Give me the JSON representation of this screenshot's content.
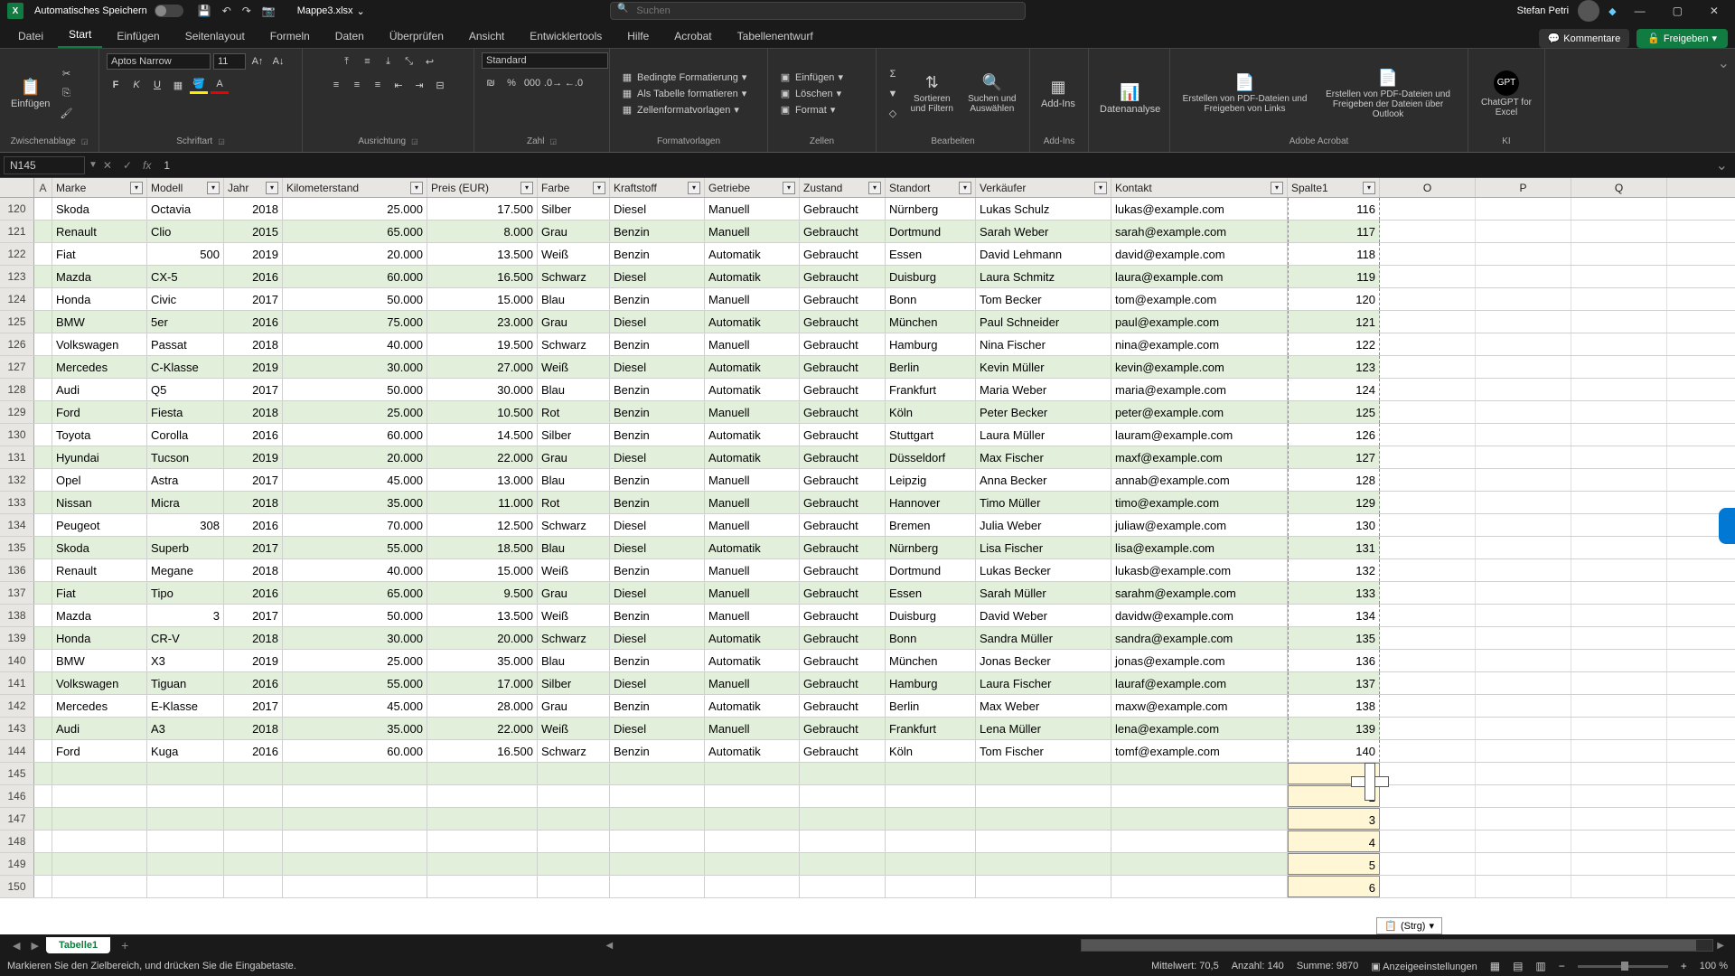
{
  "titlebar": {
    "autosave": "Automatisches Speichern",
    "filename": "Mappe3.xlsx",
    "search_placeholder": "Suchen",
    "user": "Stefan Petri"
  },
  "tabs": {
    "datei": "Datei",
    "start": "Start",
    "einfuegen": "Einfügen",
    "seitenlayout": "Seitenlayout",
    "formeln": "Formeln",
    "daten": "Daten",
    "ueberpruefen": "Überprüfen",
    "ansicht": "Ansicht",
    "entwickler": "Entwicklertools",
    "hilfe": "Hilfe",
    "acrobat": "Acrobat",
    "tabellenentwurf": "Tabellenentwurf",
    "kommentare": "Kommentare",
    "freigeben": "Freigeben"
  },
  "ribbon": {
    "zwischenablage": {
      "label": "Zwischenablage",
      "einfuegen": "Einfügen"
    },
    "schriftart": {
      "label": "Schriftart",
      "font": "Aptos Narrow",
      "size": "11"
    },
    "ausrichtung": {
      "label": "Ausrichtung"
    },
    "zahl": {
      "label": "Zahl",
      "format": "Standard"
    },
    "formatvorlagen": {
      "label": "Formatvorlagen",
      "bedingte": "Bedingte Formatierung",
      "alstabelle": "Als Tabelle formatieren",
      "zellen": "Zellenformatvorlagen"
    },
    "zellen": {
      "label": "Zellen",
      "einfuegen": "Einfügen",
      "loeschen": "Löschen",
      "format": "Format"
    },
    "bearbeiten": {
      "label": "Bearbeiten",
      "sortieren": "Sortieren und Filtern",
      "suchen": "Suchen und Auswählen"
    },
    "addins": {
      "label": "Add-Ins",
      "addins": "Add-Ins"
    },
    "analyse": {
      "label": "",
      "datenanalyse": "Datenanalyse"
    },
    "adobe": {
      "label": "Adobe Acrobat",
      "pdf1": "Erstellen von PDF-Dateien und Freigeben von Links",
      "pdf2": "Erstellen von PDF-Dateien und Freigeben der Dateien über Outlook"
    },
    "ki": {
      "label": "KI",
      "chatgpt": "ChatGPT for Excel"
    }
  },
  "formula": {
    "namebox": "N145",
    "value": "1"
  },
  "headers": {
    "a": "A",
    "marke": "Marke",
    "modell": "Modell",
    "jahr": "Jahr",
    "km": "Kilometerstand",
    "preis": "Preis (EUR)",
    "farbe": "Farbe",
    "kraft": "Kraftstoff",
    "getriebe": "Getriebe",
    "zustand": "Zustand",
    "standort": "Standort",
    "verk": "Verkäufer",
    "kontakt": "Kontakt",
    "spalte": "Spalte1",
    "o": "O",
    "p": "P",
    "q": "Q"
  },
  "rows": [
    {
      "n": 120,
      "marke": "Skoda",
      "modell": "Octavia",
      "jahr": "2018",
      "km": "25.000",
      "preis": "17.500",
      "farbe": "Silber",
      "kraft": "Diesel",
      "getriebe": "Manuell",
      "zustand": "Gebraucht",
      "standort": "Nürnberg",
      "verk": "Lukas Schulz",
      "kontakt": "lukas@example.com",
      "sp": "116"
    },
    {
      "n": 121,
      "marke": "Renault",
      "modell": "Clio",
      "jahr": "2015",
      "km": "65.000",
      "preis": "8.000",
      "farbe": "Grau",
      "kraft": "Benzin",
      "getriebe": "Manuell",
      "zustand": "Gebraucht",
      "standort": "Dortmund",
      "verk": "Sarah Weber",
      "kontakt": "sarah@example.com",
      "sp": "117"
    },
    {
      "n": 122,
      "marke": "Fiat",
      "modell": "500",
      "jahr": "2019",
      "km": "20.000",
      "preis": "13.500",
      "farbe": "Weiß",
      "kraft": "Benzin",
      "getriebe": "Automatik",
      "zustand": "Gebraucht",
      "standort": "Essen",
      "verk": "David Lehmann",
      "kontakt": "david@example.com",
      "sp": "118"
    },
    {
      "n": 123,
      "marke": "Mazda",
      "modell": "CX-5",
      "jahr": "2016",
      "km": "60.000",
      "preis": "16.500",
      "farbe": "Schwarz",
      "kraft": "Diesel",
      "getriebe": "Automatik",
      "zustand": "Gebraucht",
      "standort": "Duisburg",
      "verk": "Laura Schmitz",
      "kontakt": "laura@example.com",
      "sp": "119"
    },
    {
      "n": 124,
      "marke": "Honda",
      "modell": "Civic",
      "jahr": "2017",
      "km": "50.000",
      "preis": "15.000",
      "farbe": "Blau",
      "kraft": "Benzin",
      "getriebe": "Manuell",
      "zustand": "Gebraucht",
      "standort": "Bonn",
      "verk": "Tom Becker",
      "kontakt": "tom@example.com",
      "sp": "120"
    },
    {
      "n": 125,
      "marke": "BMW",
      "modell": "5er",
      "jahr": "2016",
      "km": "75.000",
      "preis": "23.000",
      "farbe": "Grau",
      "kraft": "Diesel",
      "getriebe": "Automatik",
      "zustand": "Gebraucht",
      "standort": "München",
      "verk": "Paul Schneider",
      "kontakt": "paul@example.com",
      "sp": "121"
    },
    {
      "n": 126,
      "marke": "Volkswagen",
      "modell": "Passat",
      "jahr": "2018",
      "km": "40.000",
      "preis": "19.500",
      "farbe": "Schwarz",
      "kraft": "Benzin",
      "getriebe": "Manuell",
      "zustand": "Gebraucht",
      "standort": "Hamburg",
      "verk": "Nina Fischer",
      "kontakt": "nina@example.com",
      "sp": "122"
    },
    {
      "n": 127,
      "marke": "Mercedes",
      "modell": "C-Klasse",
      "jahr": "2019",
      "km": "30.000",
      "preis": "27.000",
      "farbe": "Weiß",
      "kraft": "Diesel",
      "getriebe": "Automatik",
      "zustand": "Gebraucht",
      "standort": "Berlin",
      "verk": "Kevin Müller",
      "kontakt": "kevin@example.com",
      "sp": "123"
    },
    {
      "n": 128,
      "marke": "Audi",
      "modell": "Q5",
      "jahr": "2017",
      "km": "50.000",
      "preis": "30.000",
      "farbe": "Blau",
      "kraft": "Benzin",
      "getriebe": "Automatik",
      "zustand": "Gebraucht",
      "standort": "Frankfurt",
      "verk": "Maria Weber",
      "kontakt": "maria@example.com",
      "sp": "124"
    },
    {
      "n": 129,
      "marke": "Ford",
      "modell": "Fiesta",
      "jahr": "2018",
      "km": "25.000",
      "preis": "10.500",
      "farbe": "Rot",
      "kraft": "Benzin",
      "getriebe": "Manuell",
      "zustand": "Gebraucht",
      "standort": "Köln",
      "verk": "Peter Becker",
      "kontakt": "peter@example.com",
      "sp": "125"
    },
    {
      "n": 130,
      "marke": "Toyota",
      "modell": "Corolla",
      "jahr": "2016",
      "km": "60.000",
      "preis": "14.500",
      "farbe": "Silber",
      "kraft": "Benzin",
      "getriebe": "Automatik",
      "zustand": "Gebraucht",
      "standort": "Stuttgart",
      "verk": "Laura Müller",
      "kontakt": "lauram@example.com",
      "sp": "126"
    },
    {
      "n": 131,
      "marke": "Hyundai",
      "modell": "Tucson",
      "jahr": "2019",
      "km": "20.000",
      "preis": "22.000",
      "farbe": "Grau",
      "kraft": "Diesel",
      "getriebe": "Automatik",
      "zustand": "Gebraucht",
      "standort": "Düsseldorf",
      "verk": "Max Fischer",
      "kontakt": "maxf@example.com",
      "sp": "127"
    },
    {
      "n": 132,
      "marke": "Opel",
      "modell": "Astra",
      "jahr": "2017",
      "km": "45.000",
      "preis": "13.000",
      "farbe": "Blau",
      "kraft": "Benzin",
      "getriebe": "Manuell",
      "zustand": "Gebraucht",
      "standort": "Leipzig",
      "verk": "Anna Becker",
      "kontakt": "annab@example.com",
      "sp": "128"
    },
    {
      "n": 133,
      "marke": "Nissan",
      "modell": "Micra",
      "jahr": "2018",
      "km": "35.000",
      "preis": "11.000",
      "farbe": "Rot",
      "kraft": "Benzin",
      "getriebe": "Manuell",
      "zustand": "Gebraucht",
      "standort": "Hannover",
      "verk": "Timo Müller",
      "kontakt": "timo@example.com",
      "sp": "129"
    },
    {
      "n": 134,
      "marke": "Peugeot",
      "modell": "308",
      "jahr": "2016",
      "km": "70.000",
      "preis": "12.500",
      "farbe": "Schwarz",
      "kraft": "Diesel",
      "getriebe": "Manuell",
      "zustand": "Gebraucht",
      "standort": "Bremen",
      "verk": "Julia Weber",
      "kontakt": "juliaw@example.com",
      "sp": "130"
    },
    {
      "n": 135,
      "marke": "Skoda",
      "modell": "Superb",
      "jahr": "2017",
      "km": "55.000",
      "preis": "18.500",
      "farbe": "Blau",
      "kraft": "Diesel",
      "getriebe": "Automatik",
      "zustand": "Gebraucht",
      "standort": "Nürnberg",
      "verk": "Lisa Fischer",
      "kontakt": "lisa@example.com",
      "sp": "131"
    },
    {
      "n": 136,
      "marke": "Renault",
      "modell": "Megane",
      "jahr": "2018",
      "km": "40.000",
      "preis": "15.000",
      "farbe": "Weiß",
      "kraft": "Benzin",
      "getriebe": "Manuell",
      "zustand": "Gebraucht",
      "standort": "Dortmund",
      "verk": "Lukas Becker",
      "kontakt": "lukasb@example.com",
      "sp": "132"
    },
    {
      "n": 137,
      "marke": "Fiat",
      "modell": "Tipo",
      "jahr": "2016",
      "km": "65.000",
      "preis": "9.500",
      "farbe": "Grau",
      "kraft": "Diesel",
      "getriebe": "Manuell",
      "zustand": "Gebraucht",
      "standort": "Essen",
      "verk": "Sarah Müller",
      "kontakt": "sarahm@example.com",
      "sp": "133"
    },
    {
      "n": 138,
      "marke": "Mazda",
      "modell": "3",
      "jahr": "2017",
      "km": "50.000",
      "preis": "13.500",
      "farbe": "Weiß",
      "kraft": "Benzin",
      "getriebe": "Manuell",
      "zustand": "Gebraucht",
      "standort": "Duisburg",
      "verk": "David Weber",
      "kontakt": "davidw@example.com",
      "sp": "134"
    },
    {
      "n": 139,
      "marke": "Honda",
      "modell": "CR-V",
      "jahr": "2018",
      "km": "30.000",
      "preis": "20.000",
      "farbe": "Schwarz",
      "kraft": "Diesel",
      "getriebe": "Automatik",
      "zustand": "Gebraucht",
      "standort": "Bonn",
      "verk": "Sandra Müller",
      "kontakt": "sandra@example.com",
      "sp": "135"
    },
    {
      "n": 140,
      "marke": "BMW",
      "modell": "X3",
      "jahr": "2019",
      "km": "25.000",
      "preis": "35.000",
      "farbe": "Blau",
      "kraft": "Benzin",
      "getriebe": "Automatik",
      "zustand": "Gebraucht",
      "standort": "München",
      "verk": "Jonas Becker",
      "kontakt": "jonas@example.com",
      "sp": "136"
    },
    {
      "n": 141,
      "marke": "Volkswagen",
      "modell": "Tiguan",
      "jahr": "2016",
      "km": "55.000",
      "preis": "17.000",
      "farbe": "Silber",
      "kraft": "Diesel",
      "getriebe": "Manuell",
      "zustand": "Gebraucht",
      "standort": "Hamburg",
      "verk": "Laura Fischer",
      "kontakt": "lauraf@example.com",
      "sp": "137"
    },
    {
      "n": 142,
      "marke": "Mercedes",
      "modell": "E-Klasse",
      "jahr": "2017",
      "km": "45.000",
      "preis": "28.000",
      "farbe": "Grau",
      "kraft": "Benzin",
      "getriebe": "Automatik",
      "zustand": "Gebraucht",
      "standort": "Berlin",
      "verk": "Max Weber",
      "kontakt": "maxw@example.com",
      "sp": "138"
    },
    {
      "n": 143,
      "marke": "Audi",
      "modell": "A3",
      "jahr": "2018",
      "km": "35.000",
      "preis": "22.000",
      "farbe": "Weiß",
      "kraft": "Diesel",
      "getriebe": "Manuell",
      "zustand": "Gebraucht",
      "standort": "Frankfurt",
      "verk": "Lena Müller",
      "kontakt": "lena@example.com",
      "sp": "139"
    },
    {
      "n": 144,
      "marke": "Ford",
      "modell": "Kuga",
      "jahr": "2016",
      "km": "60.000",
      "preis": "16.500",
      "farbe": "Schwarz",
      "kraft": "Benzin",
      "getriebe": "Automatik",
      "zustand": "Gebraucht",
      "standort": "Köln",
      "verk": "Tom Fischer",
      "kontakt": "tomf@example.com",
      "sp": "140"
    }
  ],
  "empty_rows": [
    {
      "n": 145,
      "sp": "1"
    },
    {
      "n": 146,
      "sp": "2"
    },
    {
      "n": 147,
      "sp": "3"
    },
    {
      "n": 148,
      "sp": "4"
    },
    {
      "n": 149,
      "sp": "5"
    },
    {
      "n": 150,
      "sp": "6"
    }
  ],
  "sheet": {
    "tab1": "Tabelle1"
  },
  "status": {
    "hint": "Markieren Sie den Zielbereich, und drücken Sie die Eingabetaste.",
    "mittelwert": "Mittelwert: 70,5",
    "anzahl": "Anzahl: 140",
    "summe": "Summe: 9870",
    "anzeige": "Anzeigeeinstellungen",
    "zoom": "100 %"
  },
  "popup": {
    "strg": "(Strg)"
  }
}
